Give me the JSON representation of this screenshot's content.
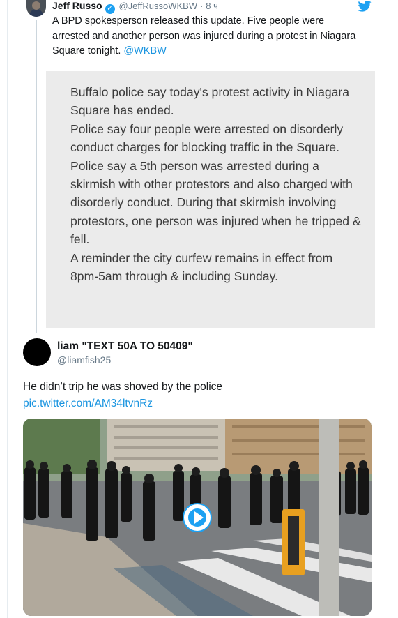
{
  "quoted_tweet": {
    "author_name": "Jeff Russo",
    "handle": "@JeffRussoWKBW",
    "separator": "·",
    "time": "8 ч",
    "text": "A BPD spokesperson released this update. Five people were arrested and another person was injured during a protest in Niagara Square tonight.",
    "mention": "@WKBW",
    "statement_paragraphs": [
      "Buffalo police say today's protest activity in Niagara Square has ended.",
      "Police say four people were arrested on disorderly conduct charges for blocking traffic in the Square.",
      "Police say a 5th person was arrested during a skirmish with other protestors and also charged with disorderly conduct. During that skirmish involving protestors, one person was injured when he tripped & fell.",
      "A reminder the city curfew remains in effect from 8pm-5am through & including Sunday."
    ]
  },
  "reply_tweet": {
    "author_name": "liam \"TEXT 50A TO 50409\"",
    "handle": "@liamfish25",
    "text": "He didn’t trip he was shoved by the police",
    "link": "pic.twitter.com/AM34ltvnRz"
  },
  "colors": {
    "twitter_blue": "#1da1f2",
    "link_blue": "#1b95e0",
    "secondary_text": "#657786",
    "thread_line": "#ccd6dd"
  },
  "icons": [
    "verified-badge-icon",
    "twitter-bird-icon",
    "play-icon"
  ]
}
